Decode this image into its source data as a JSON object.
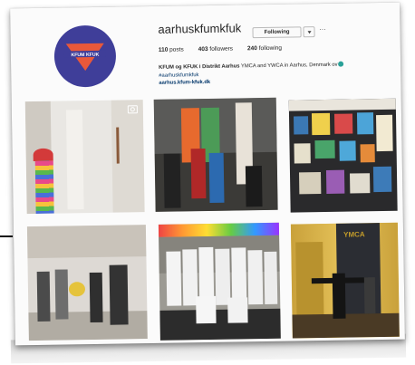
{
  "profile": {
    "username": "aarhuskfumkfuk",
    "follow_label": "Following",
    "more_label": "...",
    "avatar_text": "KFUM KFUK",
    "stats": {
      "posts": "110",
      "posts_label": "posts",
      "followers": "403",
      "followers_label": "followers",
      "following": "240",
      "following_label": "following"
    },
    "bio": {
      "name": "KFUM og KFUK i Distrikt Aarhus",
      "line1_rest": " YMCA and YWCA in Aarhus, Denmark ov",
      "hashtag": "#aarhuskfumkfuk",
      "link": "aarhus.kfum-kfuk.dk"
    }
  },
  "grid": {
    "posts": [
      {
        "name": "post-costume-child"
      },
      {
        "name": "post-climbing-group"
      },
      {
        "name": "post-bulletin-board"
      },
      {
        "name": "post-people-gathering"
      },
      {
        "name": "post-group-white-shirts"
      },
      {
        "name": "post-ymca-banner",
        "badge_text": "YMCA"
      }
    ]
  },
  "colors": {
    "accent": "#3f3e99",
    "logo_triangle": "#e8583a",
    "link": "#003569"
  }
}
